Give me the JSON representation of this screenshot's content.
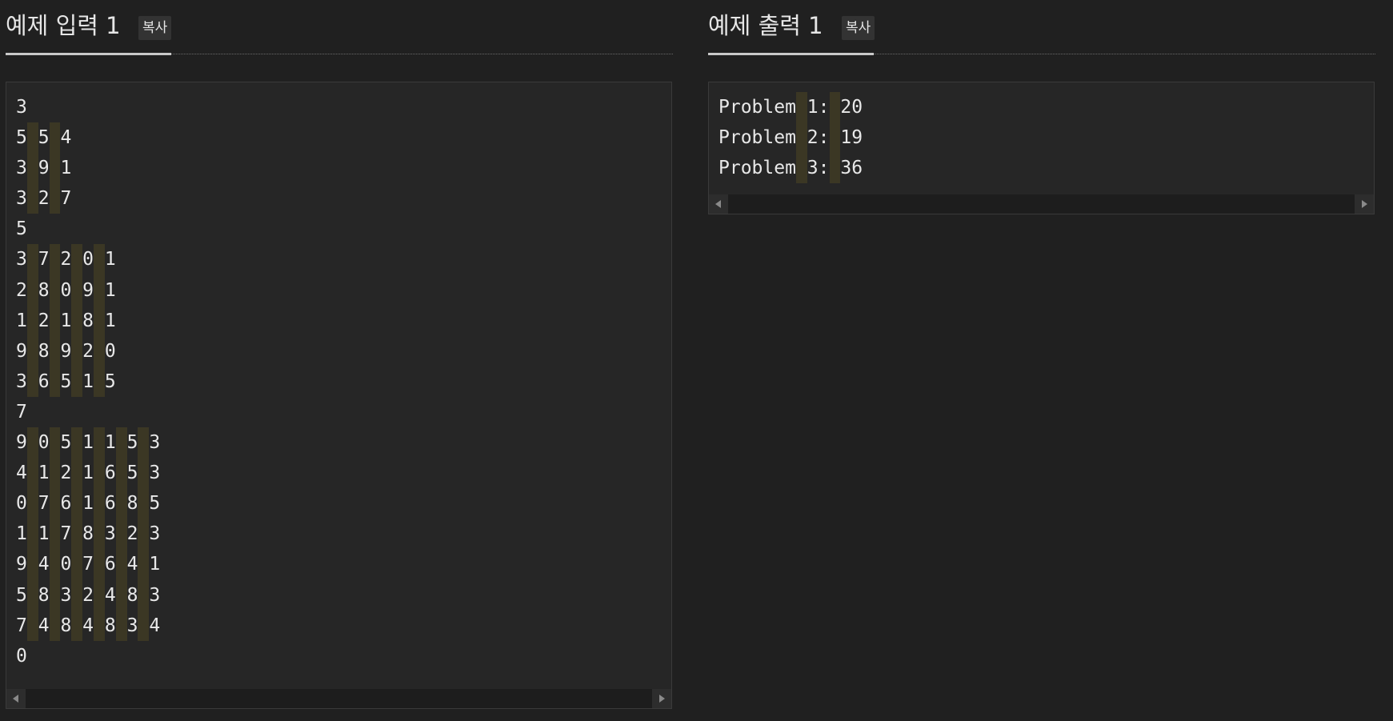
{
  "input_panel": {
    "title": "예제 입력 1",
    "copy_label": "복사",
    "lines": [
      "3",
      "5 5 4",
      "3 9 1",
      "3 2 7",
      "5",
      "3 7 2 0 1",
      "2 8 0 9 1",
      "1 2 1 8 1",
      "9 8 9 2 0",
      "3 6 5 1 5",
      "7",
      "9 0 5 1 1 5 3",
      "4 1 2 1 6 5 3",
      "0 7 6 1 6 8 5",
      "1 1 7 8 3 2 3",
      "9 4 0 7 6 4 1",
      "5 8 3 2 4 8 3",
      "7 4 8 4 8 3 4",
      "0"
    ]
  },
  "output_panel": {
    "title": "예제 출력 1",
    "copy_label": "복사",
    "lines": [
      "Problem 1: 20",
      "Problem 2: 19",
      "Problem 3: 36"
    ]
  },
  "icons": {
    "scroll_left": "chevron-left-icon",
    "scroll_right": "chevron-right-icon"
  },
  "colors": {
    "background": "#202020",
    "box_background": "#262626",
    "space_highlight": "#3b3724",
    "text": "#e8e8e8"
  }
}
